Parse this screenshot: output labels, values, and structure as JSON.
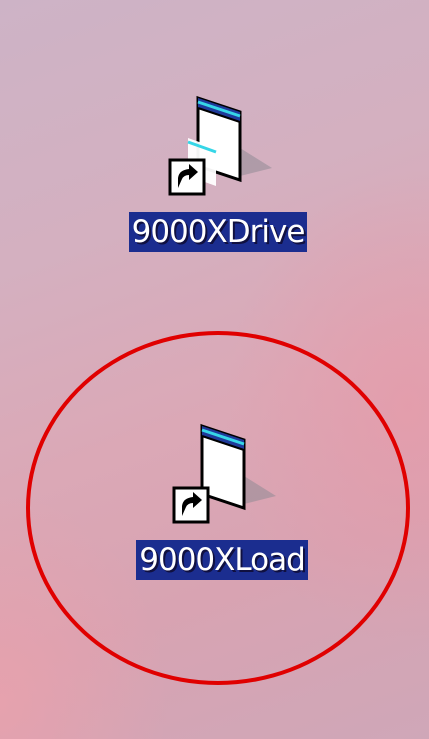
{
  "desktop": {
    "shortcuts": [
      {
        "label": "9000XDrive",
        "icon": "application-window-shortcut-icon",
        "badge_icon": "shortcut-arrow-icon"
      },
      {
        "label": "9000XLoad",
        "icon": "application-window-shortcut-icon",
        "badge_icon": "shortcut-arrow-icon"
      }
    ],
    "annotation": {
      "shape": "circle",
      "color": "#e00000",
      "target": "9000XLoad"
    }
  }
}
